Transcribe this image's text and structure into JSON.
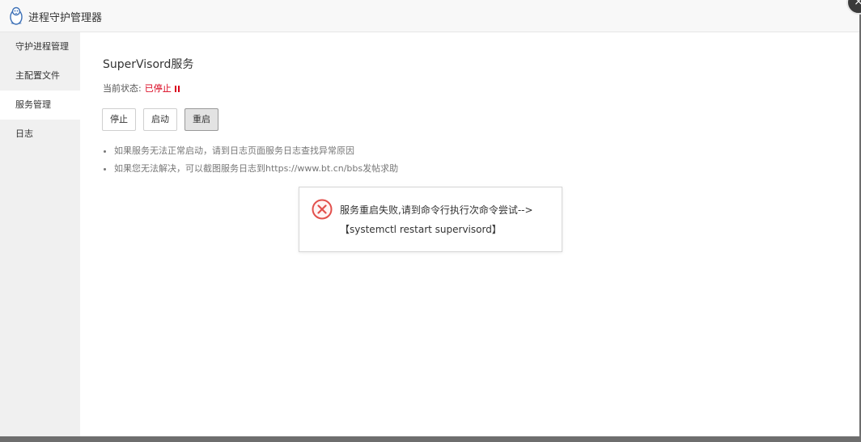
{
  "window": {
    "title": "进程守护管理器",
    "close_icon": "close-icon"
  },
  "sidebar": {
    "items": [
      {
        "label": "守护进程管理",
        "active": false
      },
      {
        "label": "主配置文件",
        "active": false
      },
      {
        "label": "服务管理",
        "active": true
      },
      {
        "label": "日志",
        "active": false
      }
    ]
  },
  "service": {
    "title": "SuperVisord服务",
    "status_label": "当前状态:",
    "status_value": "已停止",
    "status_color": "#d9001b",
    "buttons": {
      "stop": "停止",
      "start": "启动",
      "restart": "重启"
    },
    "tips": [
      "如果服务无法正常启动，请到日志页面服务日志查找异常原因",
      "如果您无法解决，可以截图服务日志到https://www.bt.cn/bbs发帖求助"
    ]
  },
  "dialog": {
    "message": "服务重启失败,请到命令行执行次命令尝试-->",
    "command": "【systemctl restart supervisord】",
    "icon": "error-icon"
  }
}
